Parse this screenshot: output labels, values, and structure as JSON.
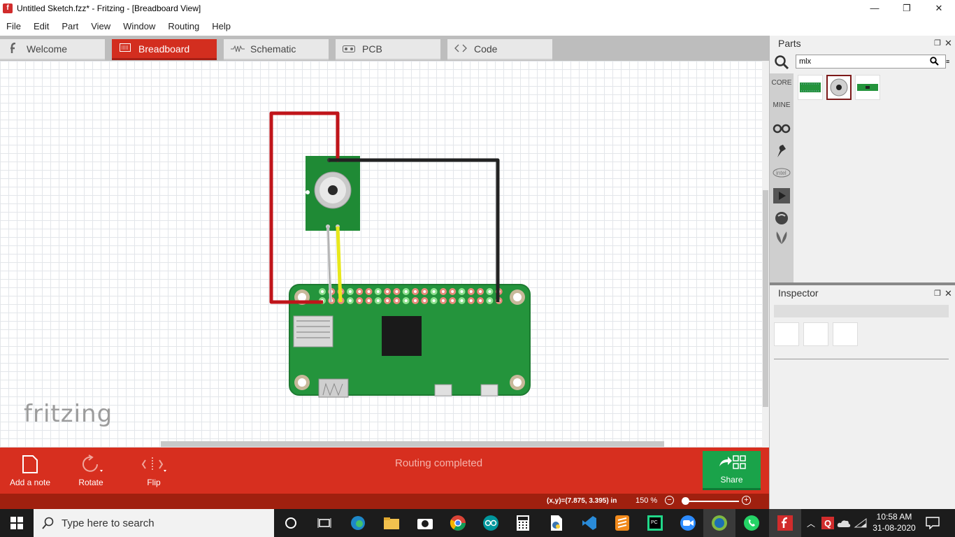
{
  "window": {
    "title": "Untitled Sketch.fzz* - Fritzing - [Breadboard View]",
    "minimize_glyph": "—",
    "restore_glyph": "❐",
    "close_glyph": "✕"
  },
  "menu": [
    "File",
    "Edit",
    "Part",
    "View",
    "Window",
    "Routing",
    "Help"
  ],
  "view_tabs": [
    {
      "label": "Welcome",
      "icon": "fritzing-f-icon",
      "active": false
    },
    {
      "label": "Breadboard",
      "icon": "breadboard-icon",
      "active": true
    },
    {
      "label": "Schematic",
      "icon": "resistor-icon",
      "active": false
    },
    {
      "label": "PCB",
      "icon": "pcb-icon",
      "active": false
    },
    {
      "label": "Code",
      "icon": "code-brackets-icon",
      "active": false
    }
  ],
  "canvas": {
    "watermark": "fritzing",
    "wires": [
      {
        "color": "#c0141a",
        "label": "red"
      },
      {
        "color": "#222222",
        "label": "black"
      },
      {
        "color": "#e8e81c",
        "label": "yellow"
      },
      {
        "color": "#d8d8d8",
        "label": "white"
      }
    ],
    "components": [
      "mlx-temperature-sensor-board",
      "raspberry-pi-zero"
    ]
  },
  "toolbar": {
    "add_note": "Add a note",
    "rotate": "Rotate",
    "flip": "Flip",
    "status": "Routing completed",
    "share": "Share"
  },
  "statusbar": {
    "coords": "(x,y)=(7.875, 3.395) in",
    "zoom": "150 %"
  },
  "parts_panel": {
    "title": "Parts",
    "search_value": "mlx",
    "bins": [
      "CORE",
      "MINE"
    ]
  },
  "inspector": {
    "title": "Inspector"
  },
  "taskbar": {
    "search_placeholder": "Type here to search",
    "time": "10:58 AM",
    "date": "31-08-2020"
  },
  "colors": {
    "accent": "#d72f1f",
    "share": "#1aa34a",
    "pcb_green": "#24943c"
  }
}
